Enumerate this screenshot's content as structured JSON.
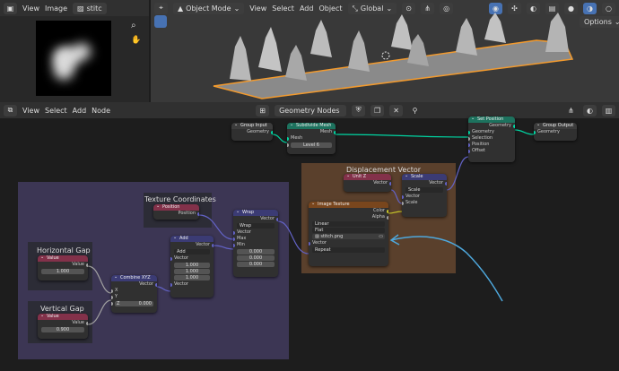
{
  "image_editor": {
    "view_label": "View",
    "image_label": "Image",
    "image_name": "stitc"
  },
  "viewport": {
    "mode_label": "Object Mode",
    "menus": [
      "View",
      "Select",
      "Add",
      "Object"
    ],
    "orientation_label": "Global",
    "options_label": "Options"
  },
  "node_editor": {
    "menus": [
      "View",
      "Select",
      "Add",
      "Node"
    ],
    "tree_name": "Geometry Nodes"
  },
  "frames": {
    "displacement": "Displacement Vector",
    "texture_coordinates": "Texture Coordinates",
    "horizontal_gap": "Horizontal Gap",
    "vertical_gap": "Vertical Gap"
  },
  "nodes": {
    "group_input": {
      "title": "Group Input",
      "out": "Geometry"
    },
    "subdivide": {
      "title": "Subdivide Mesh",
      "out": "Mesh",
      "in_mesh": "Mesh",
      "level": "Level",
      "level_value": "6"
    },
    "set_position": {
      "title": "Set Position",
      "out": "Geometry",
      "inputs": [
        "Geometry",
        "Selection",
        "Position",
        "Offset"
      ]
    },
    "group_output": {
      "title": "Group Output",
      "in": "Geometry"
    },
    "unit_z": {
      "title": "Unit Z",
      "out": "Vector"
    },
    "scale": {
      "title": "Scale",
      "out": "Vector",
      "op": "Scale",
      "in_vec": "Vector",
      "in_scale": "Scale"
    },
    "image_texture": {
      "title": "Image Texture",
      "out_color": "Color",
      "out_alpha": "Alpha",
      "interp": "Linear",
      "proj": "Flat",
      "file": "stitch.png",
      "ext": "Repeat",
      "in_vec": "Vector"
    },
    "position": {
      "title": "Position",
      "out": "Position"
    },
    "wrap": {
      "title": "Wrap",
      "out": "Vector",
      "op": "Wrap",
      "in_vec": "Vector",
      "in_max": "Max",
      "in_min": "Min",
      "vals": [
        "0.000",
        "0.000",
        "0.000"
      ]
    },
    "add": {
      "title": "Add",
      "out": "Vector",
      "op": "Add",
      "in_vec": "Vector",
      "vals": [
        "1.000",
        "1.000",
        "1.000"
      ],
      "in_vec2": "Vector"
    },
    "combine": {
      "title": "Combine XYZ",
      "out": "Vector",
      "x": "X",
      "y": "Y",
      "z": "Z",
      "z_val": "0.000"
    },
    "value_h": {
      "title": "Value",
      "out": "Value",
      "val": "1.000"
    },
    "value_v": {
      "title": "Value",
      "out": "Value",
      "val": "0.900"
    }
  },
  "colors": {
    "frame_purple": "#3c3654",
    "frame_brown": "#5a402c",
    "header_vector": "#3b3b74",
    "header_input": "#83314a",
    "header_geometry": "#1d725e",
    "header_texture": "#79461d",
    "annotation": "#4ea8dd"
  }
}
